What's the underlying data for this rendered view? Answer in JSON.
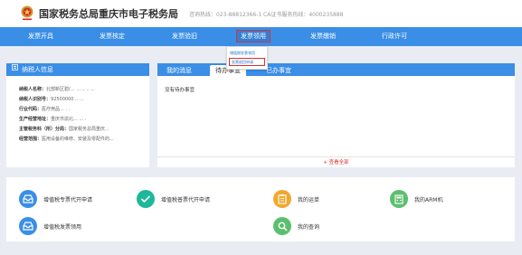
{
  "header": {
    "title": "国家税务总局重庆市电子税务局",
    "hotline": "咨询热线：023-88812366-1    CA证书服务热线：4000235888"
  },
  "nav": {
    "items": [
      "发票开具",
      "发票核定",
      "发票验旧",
      "发票领用",
      "发票缴销",
      "行政许可"
    ],
    "active_index": 3
  },
  "dropdown": {
    "items": [
      "增值税发票领用",
      "发票退回申请"
    ],
    "active_index": 1
  },
  "taxpayer": {
    "title": "纳税人信息",
    "rows": [
      {
        "label": "纳税人名称：",
        "value": "北部新区碧(... ...  .. .. ..."
      },
      {
        "label": "纳税人识别号：",
        "value": "92500000      ..  ..."
      },
      {
        "label": "行业代码：",
        "value": "医疗用品...    . ."
      },
      {
        "label": "生产经营地址：",
        "value": "重庆市渝北... ...  ."
      },
      {
        "label": "主管税务科（所）分局：",
        "value": "国家税务总局重庆..."
      },
      {
        "label": "经营范围：",
        "value": "医用设备的维修、安装及零配件的..."
      }
    ]
  },
  "messages": {
    "tabs": [
      "我的消息",
      "待办事宜",
      "已办事宜"
    ],
    "active_tab": 1,
    "empty_text": "没有待办事宜",
    "view_all": "+ 查看全部"
  },
  "services": [
    {
      "label": "增值税专票代开申请",
      "icon": "inbox-icon",
      "color": "#3a8ee6"
    },
    {
      "label": "增值税普票代开申请",
      "icon": "check-icon",
      "color": "#1fb79a"
    },
    {
      "label": "我的运单",
      "icon": "clipboard-icon",
      "color": "#f0a830"
    },
    {
      "label": "我的ARM机",
      "icon": "calculator-icon",
      "color": "#5cbf6e"
    },
    {
      "label": "增值税发票领用",
      "icon": "inbox-icon",
      "color": "#3a8ee6"
    },
    {
      "label": "我的查询",
      "icon": "search-icon",
      "color": "#5cbf6e"
    }
  ],
  "colors": {
    "primary": "#3a8ee6",
    "highlight": "#e0302a"
  }
}
